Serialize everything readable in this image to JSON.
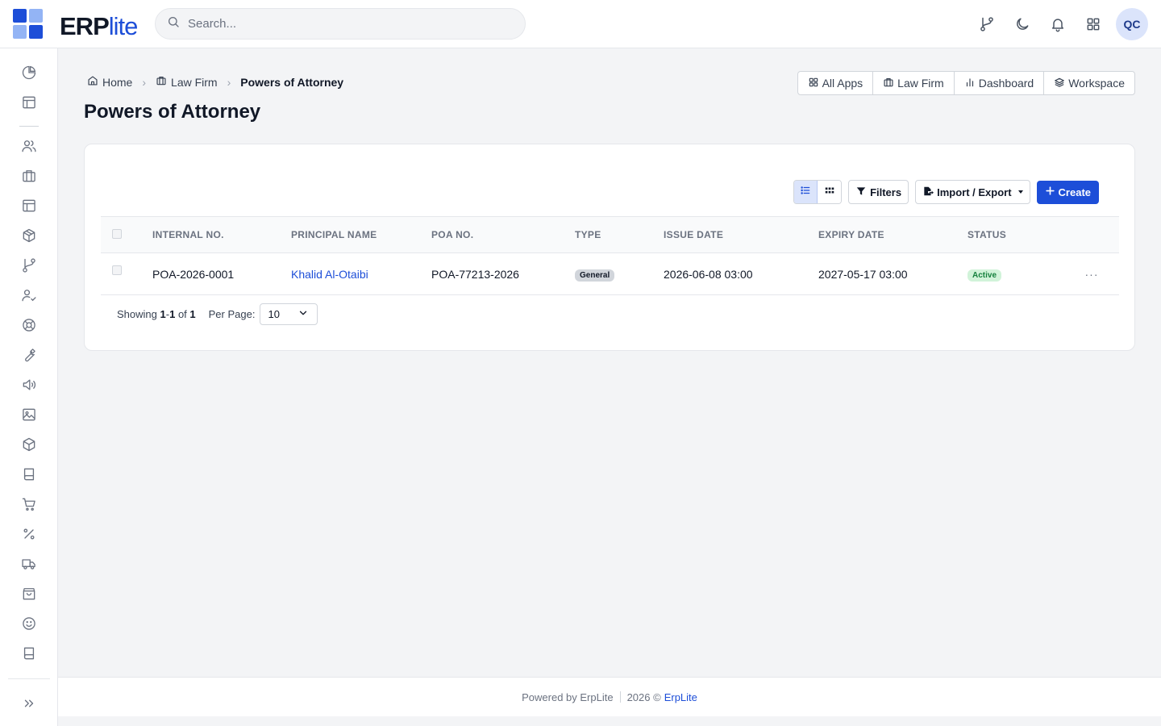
{
  "header": {
    "logo_erp": "ERP",
    "logo_lite": "lite",
    "search_placeholder": "Search...",
    "avatar_initials": "QC",
    "icons": [
      "git-branch-icon",
      "moon-icon",
      "bell-icon",
      "apps-grid-icon"
    ]
  },
  "sidebar": {
    "icons": [
      "pie-chart-icon",
      "layout-icon",
      "users-icon",
      "briefcase-icon",
      "layout-icon",
      "package-icon",
      "git-branch-icon",
      "user-check-icon",
      "lifebuoy-icon",
      "wrench-icon",
      "megaphone-icon",
      "image-icon",
      "box-icon",
      "book-icon",
      "cart-icon",
      "percent-icon",
      "truck-icon",
      "shopping-bag-icon",
      "smile-icon",
      "book-icon"
    ]
  },
  "breadcrumb": {
    "home": "Home",
    "law_firm": "Law Firm",
    "current": "Powers of Attorney"
  },
  "page": {
    "title": "Powers of Attorney"
  },
  "app_links": {
    "all_apps": "All Apps",
    "law_firm": "Law Firm",
    "dashboard": "Dashboard",
    "workspace": "Workspace"
  },
  "toolbar": {
    "filters": "Filters",
    "import_export": "Import / Export",
    "create": "Create"
  },
  "table": {
    "columns": {
      "internal_no": "INTERNAL NO.",
      "principal_name": "PRINCIPAL NAME",
      "poa_no": "POA NO.",
      "type": "TYPE",
      "issue_date": "ISSUE DATE",
      "expiry_date": "EXPIRY DATE",
      "status": "STATUS"
    },
    "rows": [
      {
        "internal_no": "POA-2026-0001",
        "principal_name": "Khalid Al-Otaibi",
        "poa_no": "POA-77213-2026",
        "type": "General",
        "issue_date": "2026-06-08 03:00",
        "expiry_date": "2027-05-17 03:00",
        "status": "Active",
        "actions": "···"
      }
    ]
  },
  "pager": {
    "showing_label": "Showing",
    "range_start": "1",
    "range_dash": "-",
    "range_end": "1",
    "of_label": "of",
    "total": "1",
    "per_page_label": "Per Page:",
    "per_page_value": "10"
  },
  "footer": {
    "powered_by": "Powered by ErpLite",
    "copyright": "2026 ©",
    "brand": "ErpLite"
  },
  "colors": {
    "accent": "#1d4ed8",
    "active_badge": "#d1f3d9",
    "general_badge": "#d1d5db"
  }
}
